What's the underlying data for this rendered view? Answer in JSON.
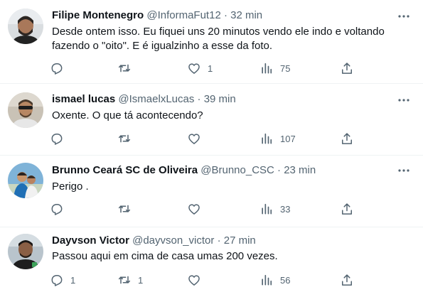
{
  "tweets": [
    {
      "name": "Filipe Montenegro",
      "handle": "@InformaFut12",
      "separator": "·",
      "time": "32 min",
      "text_lines": [
        "Desde ontem isso. Eu fiquei uns 20 minutos vendo ele indo e voltando",
        "fazendo o \"oito\". E é igualzinho a esse da foto."
      ],
      "replies": "",
      "retweets": "",
      "likes": "1",
      "views": "75"
    },
    {
      "name": "ismael lucas",
      "handle": "@IsmaelxLucas",
      "separator": "·",
      "time": "39 min",
      "text_lines": [
        "Oxente. O que tá acontecendo?"
      ],
      "replies": "",
      "retweets": "",
      "likes": "",
      "views": "107"
    },
    {
      "name": "Brunno Ceará SC de Oliveira",
      "handle": "@Brunno_CSC",
      "separator": "·",
      "time": "23 min",
      "text_lines": [
        "Perigo ."
      ],
      "replies": "",
      "retweets": "",
      "likes": "",
      "views": "33"
    },
    {
      "name": "Dayvson Victor",
      "handle": "@dayvson_victor",
      "separator": "·",
      "time": "27 min",
      "text_lines": [
        "Passou aqui em cima de casa umas 200 vezes."
      ],
      "replies": "1",
      "retweets": "1",
      "likes": "",
      "views": "56"
    }
  ],
  "icons": {
    "more": "more-horizontal-icon",
    "reply": "reply-icon",
    "retweet": "retweet-icon",
    "like": "heart-icon",
    "views": "views-bar-chart-icon",
    "share": "share-icon"
  },
  "colors": {
    "text": "#0f1419",
    "secondary": "#536471",
    "divider": "#eff3f4"
  }
}
